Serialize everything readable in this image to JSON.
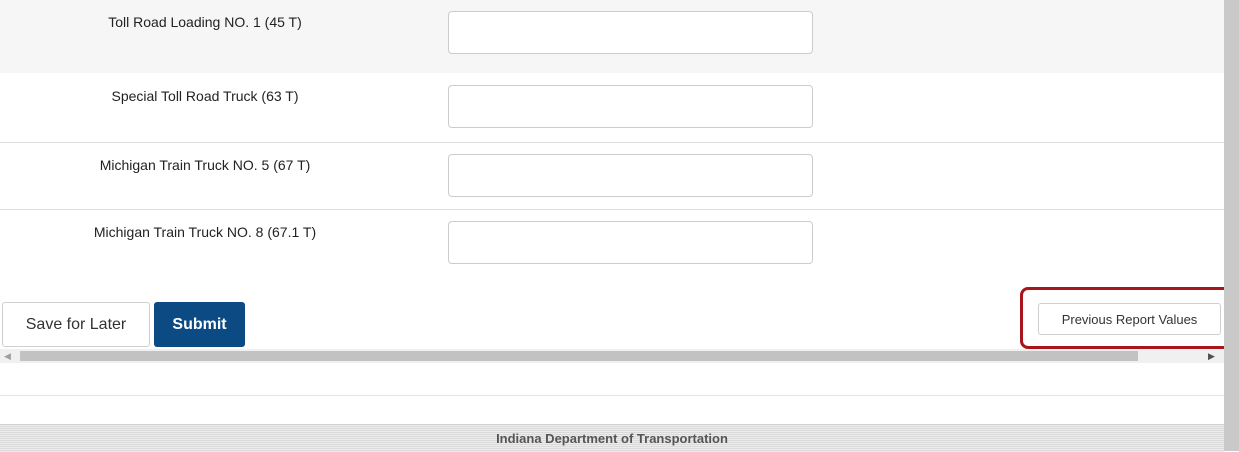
{
  "form": {
    "rows": [
      {
        "label": "Toll Road Loading NO. 1 (45 T)",
        "value": ""
      },
      {
        "label": "Special Toll Road Truck (63 T)",
        "value": ""
      },
      {
        "label": "Michigan Train Truck NO. 5 (67 T)",
        "value": ""
      },
      {
        "label": "Michigan Train Truck NO. 8 (67.1 T)",
        "value": ""
      }
    ]
  },
  "actions": {
    "save_label": "Save for Later",
    "submit_label": "Submit",
    "previous_label": "Previous Report Values"
  },
  "scrollbar": {
    "left_arrow": "◀",
    "right_arrow": "▶"
  },
  "footer": {
    "text": "Indiana Department of Transportation"
  },
  "colors": {
    "submit_bg": "#0c4a84",
    "highlight": "#a8151b"
  }
}
